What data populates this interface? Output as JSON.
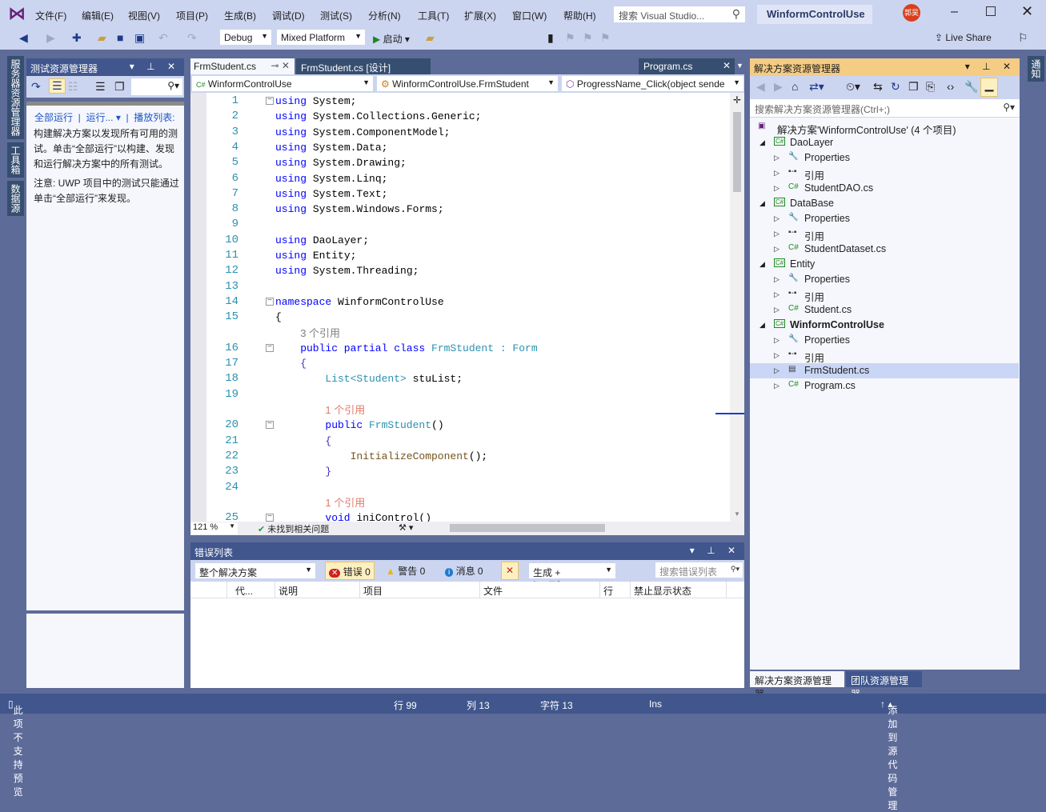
{
  "colors": {
    "accent": "#68217a",
    "title_bg": "#ccd5f0",
    "panel_header": "#40568d",
    "active_header": "#f5cc84",
    "keyword": "#0000ff",
    "type": "#2b91af"
  },
  "menu": [
    "文件(F)",
    "编辑(E)",
    "视图(V)",
    "项目(P)",
    "生成(B)",
    "调试(D)",
    "测试(S)",
    "分析(N)",
    "工具(T)",
    "扩展(X)",
    "窗口(W)",
    "帮助(H)"
  ],
  "search": {
    "placeholder": "搜索 Visual Studio..."
  },
  "title": "WinformControlUse",
  "avatar_text": "郭吴",
  "toolbar": {
    "config": "Debug",
    "platform": "Mixed Platform",
    "start": "启动",
    "live_share": "Live Share"
  },
  "left_strip": [
    "服务器资源管理器",
    "工具箱",
    "数据源"
  ],
  "right_strip": [
    "通知"
  ],
  "test_explorer": {
    "title": "测试资源管理器",
    "run_all": "全部运行",
    "run": "运行...",
    "playlist": "播放列表:",
    "message1": "构建解决方案以发现所有可用的测试。单击“全部运行”以构建、发现和运行解决方案中的所有测试。",
    "message2": "注意: UWP 项目中的测试只能通过单击“全部运行”来发现。"
  },
  "editor": {
    "tabs": [
      {
        "label": "FrmStudent.cs",
        "active": true
      },
      {
        "label": "FrmStudent.cs [设计]",
        "active": false
      }
    ],
    "right_tab": "Program.cs",
    "nav": {
      "project": "WinformControlUse",
      "class": "WinformControlUse.FrmStudent",
      "member": "ProgressName_Click(object sende"
    },
    "zoom": "121 %",
    "issues": "未找到相关问题",
    "rows": [
      {
        "n": "1",
        "fold": true,
        "ind": 0,
        "tok": [
          [
            "using",
            "k"
          ],
          [
            " System;",
            "p"
          ]
        ]
      },
      {
        "n": "2",
        "ind": 0,
        "tok": [
          [
            "using",
            "k"
          ],
          [
            " System.Collections.Generic;",
            "p"
          ]
        ]
      },
      {
        "n": "3",
        "ind": 0,
        "tok": [
          [
            "using",
            "k"
          ],
          [
            " System.ComponentModel;",
            "p"
          ]
        ]
      },
      {
        "n": "4",
        "ind": 0,
        "tok": [
          [
            "using",
            "k"
          ],
          [
            " System.Data;",
            "p"
          ]
        ]
      },
      {
        "n": "5",
        "ind": 0,
        "tok": [
          [
            "using",
            "k"
          ],
          [
            " System.Drawing;",
            "p"
          ]
        ]
      },
      {
        "n": "6",
        "ind": 0,
        "tok": [
          [
            "using",
            "k"
          ],
          [
            " System.Linq;",
            "p"
          ]
        ]
      },
      {
        "n": "7",
        "ind": 0,
        "tok": [
          [
            "using",
            "k"
          ],
          [
            " System.Text;",
            "p"
          ]
        ]
      },
      {
        "n": "8",
        "ind": 0,
        "tok": [
          [
            "using",
            "k"
          ],
          [
            " System.Windows.Forms;",
            "p"
          ]
        ]
      },
      {
        "n": "9",
        "ind": 0,
        "tok": []
      },
      {
        "n": "10",
        "ind": 0,
        "tok": [
          [
            "using",
            "k"
          ],
          [
            " DaoLayer;",
            "p"
          ]
        ]
      },
      {
        "n": "11",
        "ind": 0,
        "tok": [
          [
            "using",
            "k"
          ],
          [
            " Entity;",
            "p"
          ]
        ]
      },
      {
        "n": "12",
        "ind": 0,
        "tok": [
          [
            "using",
            "k"
          ],
          [
            " System.Threading;",
            "p"
          ]
        ]
      },
      {
        "n": "13",
        "ind": 0,
        "tok": []
      },
      {
        "n": "14",
        "fold": true,
        "ind": 0,
        "tok": [
          [
            "namespace",
            "k"
          ],
          [
            " WinformControlUse",
            "p"
          ]
        ]
      },
      {
        "n": "15",
        "ind": 0,
        "tok": [
          [
            "{",
            "p"
          ]
        ]
      },
      {
        "lens": "3 个引用",
        "ind": 1
      },
      {
        "n": "16",
        "fold": true,
        "ind": 1,
        "tok": [
          [
            "public partial class",
            "k"
          ],
          [
            " FrmStudent : Form",
            "t"
          ]
        ]
      },
      {
        "n": "17",
        "ind": 1,
        "tok": [
          [
            "{",
            "b"
          ]
        ]
      },
      {
        "n": "18",
        "ind": 2,
        "tok": [
          [
            "List<Student>",
            "t"
          ],
          [
            " stuList;",
            "p"
          ]
        ]
      },
      {
        "n": "19",
        "ind": 2,
        "tok": []
      },
      {
        "lens": "1 个引用",
        "ind": 2
      },
      {
        "n": "20",
        "fold": true,
        "ind": 2,
        "tok": [
          [
            "public",
            "k"
          ],
          [
            " FrmStudent",
            "t"
          ],
          [
            "()",
            "p"
          ]
        ]
      },
      {
        "n": "21",
        "ind": 2,
        "tok": [
          [
            "{",
            "b"
          ]
        ]
      },
      {
        "n": "22",
        "ind": 3,
        "tok": [
          [
            "InitializeComponent",
            "m"
          ],
          [
            "();",
            "p"
          ]
        ]
      },
      {
        "n": "23",
        "ind": 2,
        "tok": [
          [
            "}",
            "b"
          ]
        ]
      },
      {
        "n": "24",
        "ind": 2,
        "tok": []
      },
      {
        "lens": "1 个引用",
        "ind": 2
      },
      {
        "n": "25",
        "fold": true,
        "ind": 2,
        "tok": [
          [
            "void",
            "k"
          ],
          [
            " iniControl()",
            "p"
          ]
        ]
      }
    ]
  },
  "error_list": {
    "title": "错误列表",
    "scope": "整个解决方案",
    "errors": "错误 0",
    "warnings": "警告 0",
    "messages": "消息 0",
    "source": "生成 + IntelliSense",
    "search_placeholder": "搜索错误列表",
    "columns": [
      "代...",
      "说明",
      "项目",
      "文件",
      "行",
      "禁止显示状态"
    ]
  },
  "solution_explorer": {
    "title": "解决方案资源管理器",
    "search_placeholder": "搜索解决方案资源管理器(Ctrl+;)",
    "items": [
      {
        "label": "解决方案'WinformControlUse' (4 个项目)",
        "level": 0,
        "icon": "solution-icon",
        "exp": ""
      },
      {
        "label": "DaoLayer",
        "level": 1,
        "icon": "csproj-icon",
        "exp": "open"
      },
      {
        "label": "Properties",
        "level": 2,
        "icon": "wrench-icon",
        "exp": "closed"
      },
      {
        "label": "引用",
        "level": 2,
        "icon": "references-icon",
        "exp": "closed"
      },
      {
        "label": "StudentDAO.cs",
        "level": 2,
        "icon": "csharp-file-icon",
        "exp": "closed"
      },
      {
        "label": "DataBase",
        "level": 1,
        "icon": "csproj-icon",
        "exp": "open"
      },
      {
        "label": "Properties",
        "level": 2,
        "icon": "wrench-icon",
        "exp": "closed"
      },
      {
        "label": "引用",
        "level": 2,
        "icon": "references-icon",
        "exp": "closed"
      },
      {
        "label": "StudentDataset.cs",
        "level": 2,
        "icon": "csharp-file-icon",
        "exp": "closed"
      },
      {
        "label": "Entity",
        "level": 1,
        "icon": "csproj-icon",
        "exp": "open"
      },
      {
        "label": "Properties",
        "level": 2,
        "icon": "wrench-icon",
        "exp": "closed"
      },
      {
        "label": "引用",
        "level": 2,
        "icon": "references-icon",
        "exp": "closed"
      },
      {
        "label": "Student.cs",
        "level": 2,
        "icon": "csharp-file-icon",
        "exp": "closed"
      },
      {
        "label": "WinformControlUse",
        "level": 1,
        "icon": "csproj-icon",
        "exp": "open",
        "bold": true
      },
      {
        "label": "Properties",
        "level": 2,
        "icon": "wrench-icon",
        "exp": "closed"
      },
      {
        "label": "引用",
        "level": 2,
        "icon": "references-icon",
        "exp": "closed"
      },
      {
        "label": "FrmStudent.cs",
        "level": 2,
        "icon": "form-icon",
        "exp": "closed",
        "selected": true
      },
      {
        "label": "Program.cs",
        "level": 2,
        "icon": "csharp-file-icon",
        "exp": "closed"
      }
    ],
    "bottom_tabs": [
      "解决方案资源管理器",
      "团队资源管理器"
    ]
  },
  "status": {
    "preview": "此项不支持预览",
    "line": "行 99",
    "col": "列 13",
    "char": "字符 13",
    "mode": "Ins",
    "source_control": "添加到源代码管理"
  }
}
